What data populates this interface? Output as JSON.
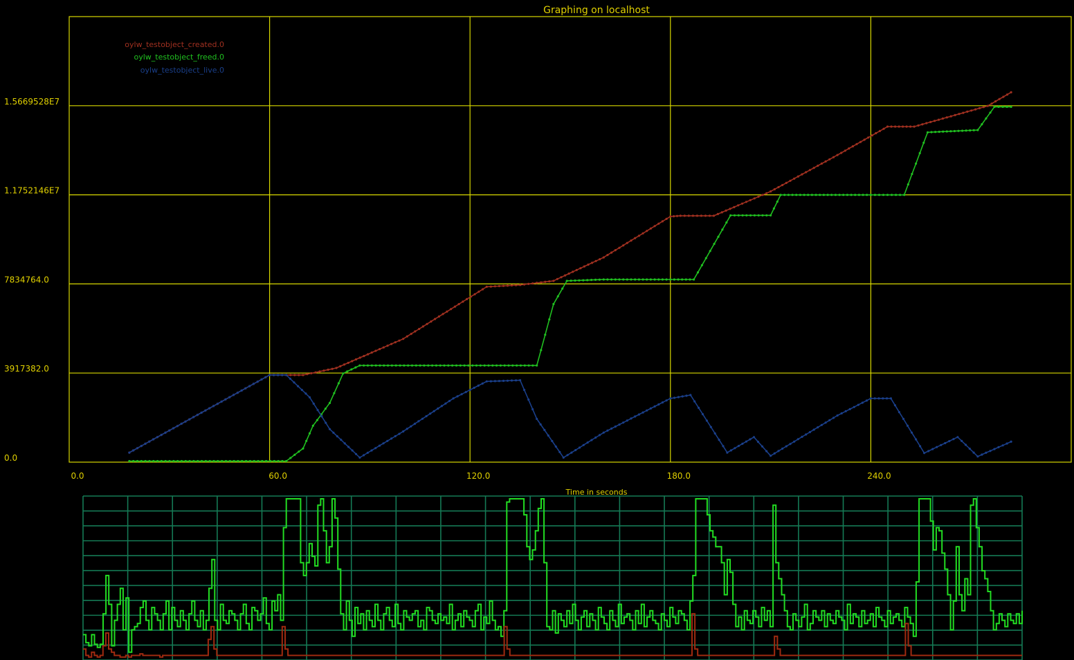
{
  "colors": {
    "background": "#000000",
    "main_grid": "#d8d800",
    "main_text": "#e0d000",
    "created": "#a03020",
    "freed": "#20c020",
    "live": "#1a3f8a",
    "cpu_grid": "#157a55",
    "cpu_user": "#22dd22",
    "cpu_system": "#a02a10"
  },
  "chart_data": [
    {
      "type": "line",
      "title": "Graphing on localhost",
      "xlabel": "Time in seconds",
      "ylabel": "",
      "xlim": [
        0,
        300
      ],
      "ylim": [
        0,
        19586910
      ],
      "x_ticks": [
        0,
        60,
        120,
        180,
        240
      ],
      "x_tick_labels": [
        "0.0",
        "60.0",
        "120.0",
        "180.0",
        "240.0"
      ],
      "y_ticks": [
        0,
        3917382,
        7834764,
        11752146,
        15669528
      ],
      "y_tick_labels": [
        "0.0",
        "3917382.0",
        "7834764.0",
        "1.1752146E7",
        "1.5669528E7"
      ],
      "grid": true,
      "legend_position": "top-left",
      "series": [
        {
          "name": "oylw_testobject_created.0",
          "color": "#a03020",
          "points": [
            [
              18,
              420000
            ],
            [
              60,
              3830000
            ],
            [
              70,
              3830000
            ],
            [
              80,
              4140000
            ],
            [
              100,
              5420000
            ],
            [
              125,
              7710000
            ],
            [
              135,
              7790000
            ],
            [
              145,
              7970000
            ],
            [
              160,
              9000000
            ],
            [
              180,
              10800000
            ],
            [
              183,
              10830000
            ],
            [
              193,
              10830000
            ],
            [
              210,
              11900000
            ],
            [
              230,
              13500000
            ],
            [
              245,
              14750000
            ],
            [
              253,
              14750000
            ],
            [
              275,
              15660000
            ],
            [
              282,
              16260000
            ]
          ]
        },
        {
          "name": "oylw_testobject_freed.0",
          "color": "#20c020",
          "points": [
            [
              18,
              45000
            ],
            [
              65,
              45000
            ],
            [
              70,
              600000
            ],
            [
              73,
              1600000
            ],
            [
              78,
              2600000
            ],
            [
              82,
              3900000
            ],
            [
              87,
              4250000
            ],
            [
              140,
              4250000
            ],
            [
              145,
              6950000
            ],
            [
              149,
              7970000
            ],
            [
              160,
              8030000
            ],
            [
              180,
              8030000
            ],
            [
              187,
              8030000
            ],
            [
              198,
              10850000
            ],
            [
              210,
              10850000
            ],
            [
              213,
              11750000
            ],
            [
              240,
              11750000
            ],
            [
              250,
              11750000
            ],
            [
              257,
              14500000
            ],
            [
              272,
              14600000
            ],
            [
              277,
              15620000
            ],
            [
              282,
              15620000
            ]
          ]
        },
        {
          "name": "oylw_testobject_live.0",
          "color": "#1a3f8a",
          "points": [
            [
              18,
              420000
            ],
            [
              60,
              3830000
            ],
            [
              65,
              3830000
            ],
            [
              72,
              2850000
            ],
            [
              78,
              1450000
            ],
            [
              87,
              200000
            ],
            [
              100,
              1350000
            ],
            [
              115,
              2800000
            ],
            [
              125,
              3550000
            ],
            [
              135,
              3600000
            ],
            [
              140,
              1900000
            ],
            [
              148,
              200000
            ],
            [
              160,
              1300000
            ],
            [
              180,
              2800000
            ],
            [
              186,
              2950000
            ],
            [
              197,
              420000
            ],
            [
              205,
              1100000
            ],
            [
              210,
              280000
            ],
            [
              230,
              2050000
            ],
            [
              240,
              2800000
            ],
            [
              246,
              2800000
            ],
            [
              256,
              400000
            ],
            [
              266,
              1100000
            ],
            [
              272,
              250000
            ],
            [
              282,
              900000
            ]
          ]
        }
      ]
    },
    {
      "type": "line",
      "title": "",
      "xlabel": "",
      "ylabel": "",
      "xlim": [
        0,
        300
      ],
      "ylim": [
        0,
        100
      ],
      "grid": true,
      "grid_rows": 11,
      "grid_cols": 21,
      "series": [
        {
          "color": "#22dd22",
          "values": [
            15,
            10,
            8,
            15,
            9,
            7,
            9,
            28,
            52,
            34,
            8,
            24,
            34,
            44,
            18,
            38,
            4,
            18,
            20,
            22,
            32,
            36,
            24,
            18,
            32,
            28,
            24,
            18,
            28,
            36,
            18,
            32,
            24,
            20,
            30,
            24,
            18,
            28,
            36,
            24,
            20,
            30,
            18,
            24,
            44,
            62,
            24,
            18,
            34,
            24,
            22,
            30,
            28,
            24,
            18,
            28,
            34,
            22,
            18,
            32,
            30,
            24,
            28,
            38,
            22,
            18,
            36,
            30,
            40,
            24,
            82,
            100,
            100,
            100,
            100,
            100,
            60,
            52,
            60,
            72,
            64,
            58,
            96,
            100,
            80,
            60,
            70,
            100,
            88,
            56,
            28,
            18,
            36,
            24,
            14,
            32,
            22,
            28,
            18,
            30,
            24,
            20,
            34,
            24,
            18,
            28,
            32,
            24,
            20,
            34,
            22,
            18,
            30,
            26,
            24,
            28,
            30,
            20,
            24,
            18,
            32,
            30,
            24,
            22,
            28,
            24,
            26,
            22,
            34,
            18,
            24,
            28,
            20,
            30,
            26,
            24,
            20,
            30,
            34,
            18,
            26,
            22,
            36,
            24,
            18,
            20,
            14,
            30,
            98,
            100,
            100,
            100,
            100,
            100,
            90,
            70,
            62,
            68,
            80,
            94,
            100,
            60,
            20,
            18,
            30,
            16,
            28,
            24,
            20,
            30,
            22,
            34,
            24,
            18,
            26,
            30,
            20,
            28,
            24,
            18,
            32,
            26,
            22,
            18,
            30,
            24,
            20,
            34,
            22,
            26,
            28,
            24,
            18,
            30,
            22,
            34,
            20,
            26,
            30,
            24,
            22,
            18,
            28,
            24,
            20,
            32,
            26,
            22,
            30,
            28,
            24,
            18,
            36,
            52,
            100,
            100,
            100,
            100,
            90,
            80,
            76,
            70,
            70,
            60,
            40,
            62,
            54,
            34,
            20,
            26,
            18,
            30,
            24,
            22,
            30,
            26,
            20,
            32,
            24,
            30,
            20,
            96,
            60,
            50,
            40,
            30,
            20,
            18,
            28,
            24,
            20,
            26,
            34,
            18,
            22,
            30,
            26,
            24,
            30,
            20,
            28,
            24,
            22,
            30,
            26,
            24,
            18,
            34,
            22,
            28,
            26,
            20,
            30,
            22,
            24,
            28,
            20,
            32,
            26,
            24,
            20,
            30,
            22,
            26,
            28,
            24,
            20,
            32,
            26,
            22,
            14,
            48,
            100,
            100,
            100,
            100,
            86,
            68,
            82,
            80,
            66,
            56,
            40,
            18,
            36,
            70,
            40,
            30,
            50,
            40,
            96,
            100,
            82,
            70,
            55,
            50,
            42,
            30,
            18,
            22,
            28,
            24,
            20,
            28,
            24,
            22,
            28,
            22,
            30
          ]
        },
        {
          "color": "#a02a10",
          "values": [
            6,
            2,
            1,
            4,
            2,
            1,
            2,
            8,
            16,
            6,
            4,
            2,
            2,
            1,
            1,
            2,
            1,
            2,
            2,
            2,
            3,
            2,
            2,
            2,
            2,
            2,
            2,
            1,
            2,
            2,
            2,
            2,
            2,
            2,
            2,
            2,
            2,
            2,
            2,
            2,
            2,
            2,
            2,
            2,
            12,
            20,
            6,
            2,
            2,
            2,
            2,
            2,
            2,
            2,
            2,
            2,
            2,
            2,
            2,
            2,
            2,
            2,
            2,
            2,
            2,
            2,
            2,
            2,
            2,
            2,
            20,
            6,
            2,
            2,
            2,
            2,
            2,
            2,
            2,
            2,
            2,
            2,
            2,
            2,
            2,
            2,
            2,
            2,
            2,
            2,
            2,
            2,
            2,
            2,
            2,
            2,
            2,
            2,
            2,
            2,
            2,
            2,
            2,
            2,
            2,
            2,
            2,
            2,
            2,
            2,
            2,
            2,
            2,
            2,
            2,
            2,
            2,
            2,
            2,
            2,
            2,
            2,
            2,
            2,
            2,
            2,
            2,
            2,
            2,
            2,
            2,
            2,
            2,
            2,
            2,
            2,
            2,
            2,
            2,
            2,
            2,
            2,
            2,
            2,
            2,
            2,
            2,
            2,
            20,
            6,
            2,
            2,
            2,
            2,
            2,
            2,
            2,
            2,
            2,
            2,
            2,
            2,
            2,
            2,
            2,
            2,
            2,
            2,
            2,
            2,
            2,
            2,
            2,
            2,
            2,
            2,
            2,
            2,
            2,
            2,
            2,
            2,
            2,
            2,
            2,
            2,
            2,
            2,
            2,
            2,
            2,
            2,
            2,
            2,
            2,
            2,
            2,
            2,
            2,
            2,
            2,
            2,
            2,
            2,
            2,
            2,
            2,
            2,
            2,
            2,
            2,
            2,
            2,
            2,
            28,
            6,
            2,
            2,
            2,
            2,
            2,
            2,
            2,
            2,
            2,
            2,
            2,
            2,
            2,
            2,
            2,
            2,
            2,
            2,
            2,
            2,
            2,
            2,
            2,
            2,
            2,
            2,
            2,
            14,
            6,
            2,
            2,
            2,
            2,
            2,
            2,
            2,
            2,
            2,
            2,
            2,
            2,
            2,
            2,
            2,
            2,
            2,
            2,
            2,
            2,
            2,
            2,
            2,
            2,
            2,
            2,
            2,
            2,
            2,
            2,
            2,
            2,
            2,
            2,
            2,
            2,
            2,
            2,
            2,
            2,
            2,
            2,
            2,
            2,
            22,
            8,
            2,
            2,
            2,
            2,
            2,
            2,
            2,
            2,
            2,
            2,
            2,
            2,
            2,
            2,
            2,
            2,
            2,
            2,
            2,
            2,
            2,
            2,
            2,
            2,
            2,
            2,
            2,
            2,
            2,
            2,
            2,
            2,
            2,
            2,
            2,
            2,
            2,
            2,
            2,
            2
          ]
        }
      ]
    }
  ]
}
